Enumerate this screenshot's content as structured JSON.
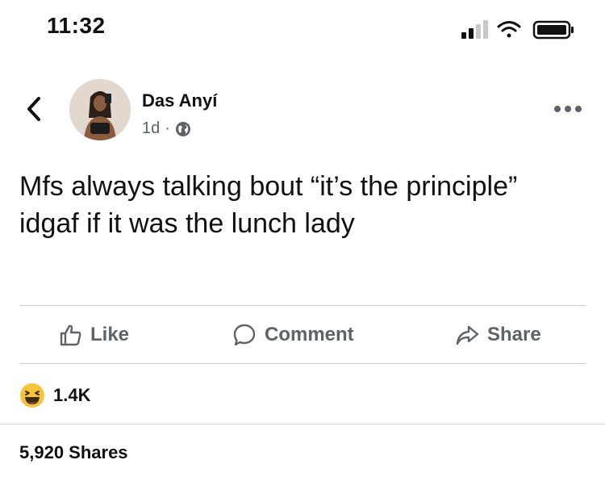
{
  "status_bar": {
    "time": "11:32"
  },
  "post": {
    "author": "Das Anyí",
    "age": "1d",
    "meta_separator": "·",
    "text": "Mfs always talking bout “it’s the principle” idgaf if it was the lunch lady"
  },
  "actions": {
    "like": "Like",
    "comment": "Comment",
    "share": "Share"
  },
  "stats": {
    "reaction_count": "1.4K",
    "shares": "5,920 Shares"
  },
  "icons": {
    "back": "chevron-left-icon",
    "privacy": "globe-icon",
    "more": "more-dots-icon",
    "like": "thumbs-up-icon",
    "comment": "comment-bubble-icon",
    "share": "share-arrow-icon",
    "reaction": "laughing-emoji-icon"
  },
  "colors": {
    "muted_text": "#5f6368",
    "reaction_yellow": "#f7c33a"
  }
}
